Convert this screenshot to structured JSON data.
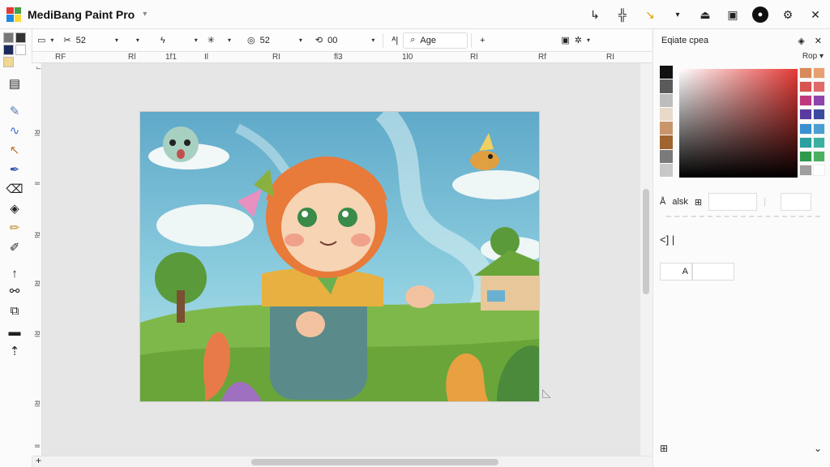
{
  "app": {
    "title": "MediBang Paint Pro"
  },
  "title_icons": [
    "pen-tablet-icon",
    "grid-icon",
    "brush-color-icon",
    "chevron-down-icon",
    "fill-icon",
    "layer-icon",
    "record-icon",
    "settings-icon"
  ],
  "options": {
    "brush_size": "52",
    "opacity_value": "52",
    "rotation_value": "00",
    "antialias_label": "Age"
  },
  "ruler": {
    "ticks": [
      "RF",
      "Rl",
      "1f1",
      "Il",
      "RI",
      "fl3",
      "1l0",
      "Rl",
      "Rf",
      "RI"
    ]
  },
  "panel": {
    "title": "Eqiate cpea",
    "sub_label": "Rop",
    "color_mode_label": "alsk",
    "bracket_label": "<]  |",
    "text_label": "A"
  },
  "colors": {
    "hues": [
      "#111111",
      "#5a5a5a",
      "#bdbdbd",
      "#e8d9c9",
      "#c9956a",
      "#a0652e",
      "#7a7a7a",
      "#c8c8c8"
    ],
    "palette": [
      "#d98a5a",
      "#e8a070",
      "#d9534f",
      "#e06a6a",
      "#c0397f",
      "#8e44ad",
      "#5a3aa0",
      "#3a4aa0",
      "#3a8fd0",
      "#4aa0d0",
      "#2aa0a0",
      "#3ab0a0",
      "#2e9a4a",
      "#4ab060",
      "#9e9e9e",
      "#ffffff"
    ]
  }
}
